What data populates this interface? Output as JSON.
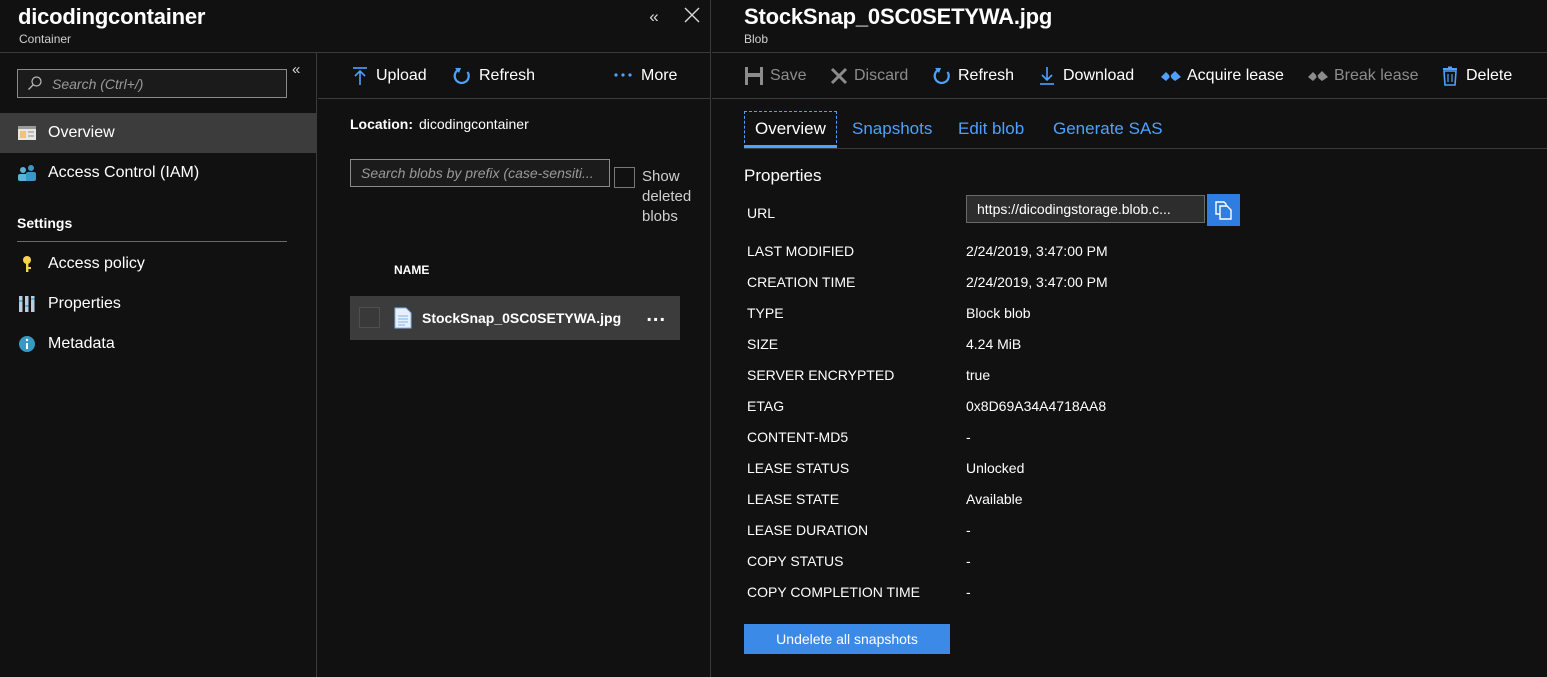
{
  "left_blade": {
    "title": "dicodingcontainer",
    "subtitle": "Container"
  },
  "nav": {
    "search_placeholder": "Search (Ctrl+/)",
    "items": [
      {
        "label": "Overview",
        "icon": "overview-icon"
      },
      {
        "label": "Access Control (IAM)",
        "icon": "iam-icon"
      }
    ],
    "settings_heading": "Settings",
    "settings_items": [
      {
        "label": "Access policy",
        "icon": "key-icon"
      },
      {
        "label": "Properties",
        "icon": "properties-icon"
      },
      {
        "label": "Metadata",
        "icon": "info-icon"
      }
    ]
  },
  "middle": {
    "toolbar": {
      "upload": "Upload",
      "refresh": "Refresh",
      "more": "More"
    },
    "location_label": "Location:",
    "location_value": "dicodingcontainer",
    "blob_search_placeholder": "Search blobs by prefix (case-sensiti...",
    "show_deleted": "Show deleted blobs",
    "column_name": "NAME",
    "blobs": [
      {
        "name": "StockSnap_0SC0SETYWA.jpg",
        "more": "..."
      }
    ]
  },
  "right_blade": {
    "title": "StockSnap_0SC0SETYWA.jpg",
    "subtitle": "Blob",
    "toolbar": {
      "save": "Save",
      "discard": "Discard",
      "refresh": "Refresh",
      "download": "Download",
      "acquire_lease": "Acquire lease",
      "break_lease": "Break lease",
      "delete": "Delete"
    },
    "tabs": [
      "Overview",
      "Snapshots",
      "Edit blob",
      "Generate SAS"
    ],
    "properties_title": "Properties",
    "url_label": "URL",
    "url_value": "https://dicodingstorage.blob.c...",
    "properties": [
      {
        "label": "LAST MODIFIED",
        "value": "2/24/2019, 3:47:00 PM"
      },
      {
        "label": "CREATION TIME",
        "value": "2/24/2019, 3:47:00 PM"
      },
      {
        "label": "TYPE",
        "value": "Block blob"
      },
      {
        "label": "SIZE",
        "value": "4.24 MiB"
      },
      {
        "label": "SERVER ENCRYPTED",
        "value": "true"
      },
      {
        "label": "ETAG",
        "value": "0x8D69A34A4718AA8"
      },
      {
        "label": "CONTENT-MD5",
        "value": "-"
      },
      {
        "label": "LEASE STATUS",
        "value": "Unlocked"
      },
      {
        "label": "LEASE STATE",
        "value": "Available"
      },
      {
        "label": "LEASE DURATION",
        "value": "-"
      },
      {
        "label": "COPY STATUS",
        "value": "-"
      },
      {
        "label": "COPY COMPLETION TIME",
        "value": "-"
      }
    ],
    "undelete_button": "Undelete all snapshots"
  },
  "colors": {
    "background": "#111111",
    "accent": "#4ea1ff",
    "button_primary": "#3c8ae8",
    "selected_row": "#3c3c3c"
  }
}
